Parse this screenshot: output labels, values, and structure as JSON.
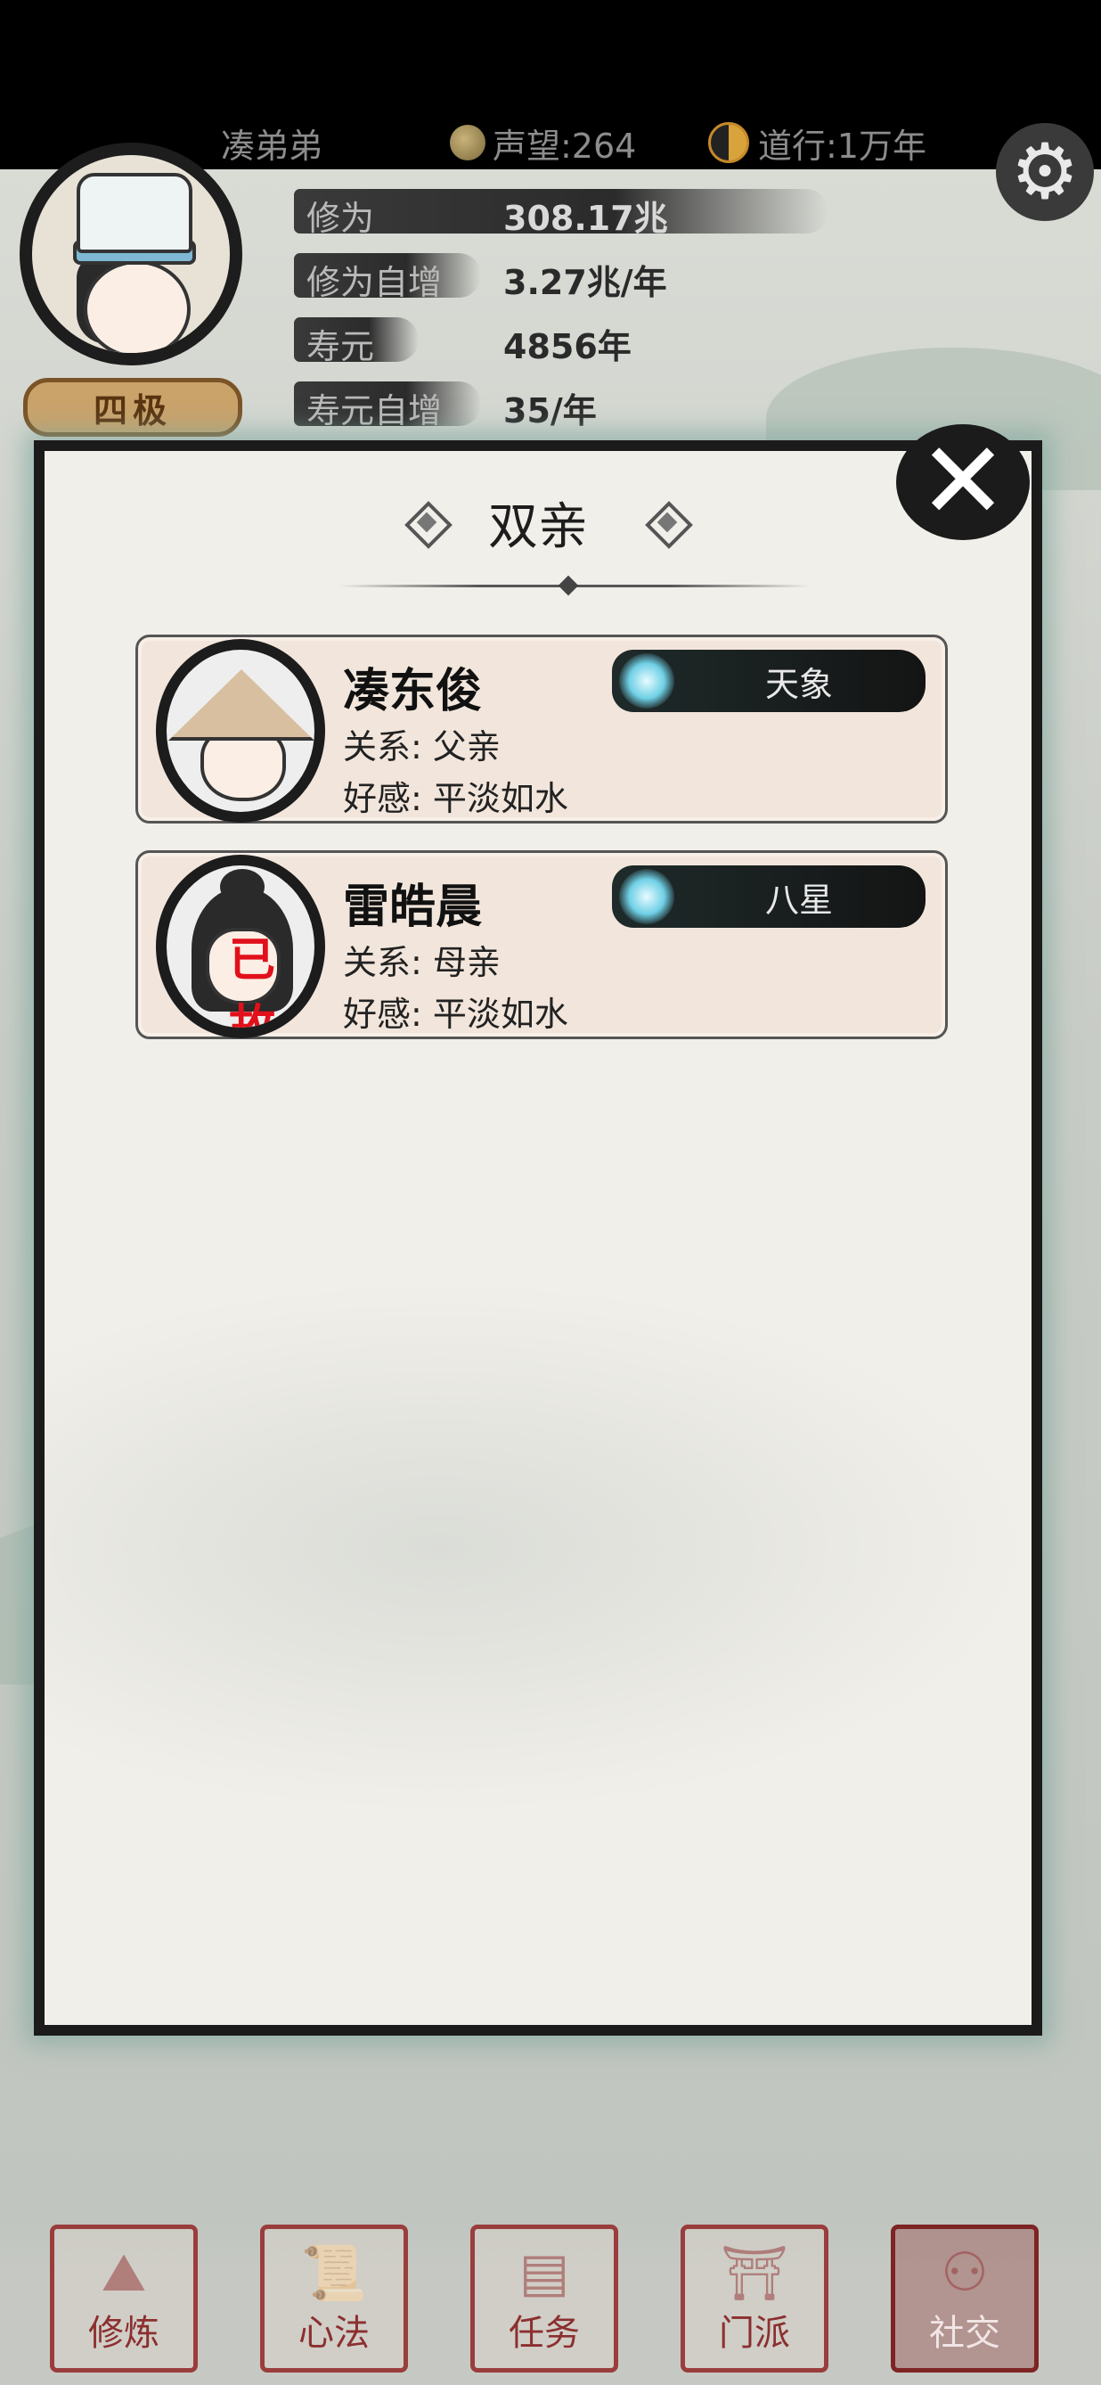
{
  "header": {
    "player_name": "凑弟弟",
    "fame": "声望:264",
    "dao": "道行:1万年",
    "rank": "四极"
  },
  "stats": [
    {
      "label": "修为",
      "value": "308.17兆"
    },
    {
      "label": "修为自增",
      "value": "3.27兆/年"
    },
    {
      "label": "寿元",
      "value": "4856年"
    },
    {
      "label": "寿元自增",
      "value": "35/年"
    }
  ],
  "dialog": {
    "title": "双亲",
    "members": [
      {
        "name": "凑东俊",
        "realm": "天象",
        "relation": "关系:  父亲",
        "favor": "好感:  平淡如水",
        "status": ""
      },
      {
        "name": "雷皓晨",
        "realm": "八星",
        "relation": "关系:  母亲",
        "favor": "好感:  平淡如水",
        "status": "已故"
      }
    ]
  },
  "nav": [
    {
      "label": "修炼",
      "icon": "mountain-icon"
    },
    {
      "label": "心法",
      "icon": "scroll-icon"
    },
    {
      "label": "任务",
      "icon": "task-scroll-icon"
    },
    {
      "label": "门派",
      "icon": "sect-gate-icon"
    },
    {
      "label": "社交",
      "icon": "people-icon"
    }
  ]
}
